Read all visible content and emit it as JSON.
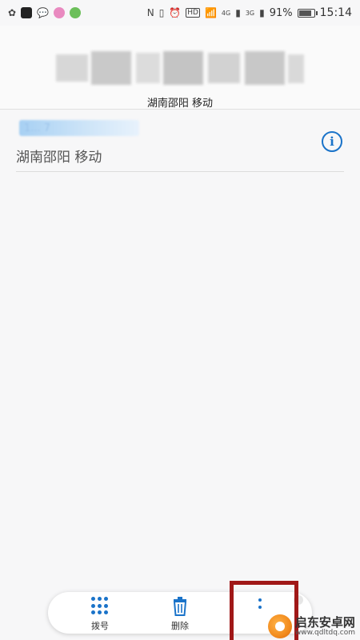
{
  "status_bar": {
    "battery_percent": "91%",
    "time": "15:14",
    "signal_labels": [
      "4G",
      "3G"
    ],
    "hd_label": "HD",
    "nfc_label": "N",
    "battery_level": 0.91
  },
  "header": {
    "number_masked": "1 ... 7",
    "location": "湖南邵阳 移动"
  },
  "entry": {
    "number_masked": "1... 7",
    "location": "湖南邵阳 移动",
    "info_glyph": "i"
  },
  "bottom_bar": {
    "dial_label": "拨号",
    "delete_label": "删除"
  },
  "watermark": {
    "name": "启东安卓网",
    "url": "www.qdltdq.com"
  },
  "colors": {
    "accent": "#1a73c9",
    "highlight": "#a01818"
  }
}
